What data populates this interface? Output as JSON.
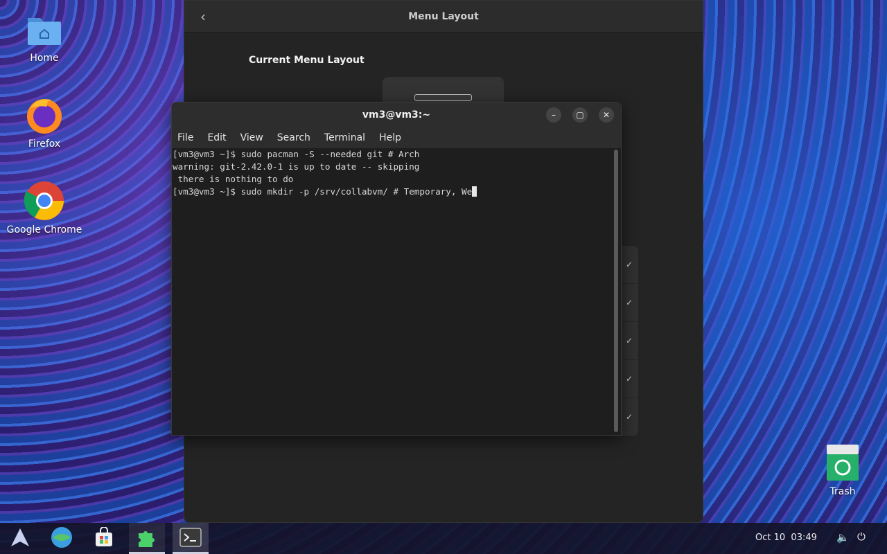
{
  "desktop": {
    "icons": [
      {
        "label": "Home"
      },
      {
        "label": "Firefox"
      },
      {
        "label": "Google Chrome"
      },
      {
        "label": "Trash"
      }
    ]
  },
  "settings": {
    "title": "Menu Layout",
    "heading": "Current Menu Layout"
  },
  "terminal": {
    "title": "vm3@vm3:~",
    "menu": [
      "File",
      "Edit",
      "View",
      "Search",
      "Terminal",
      "Help"
    ],
    "lines": [
      "[vm3@vm3 ~]$ sudo pacman -S --needed git # Arch",
      "warning: git-2.42.0-1 is up to date -- skipping",
      " there is nothing to do",
      "[vm3@vm3 ~]$ sudo mkdir -p /srv/collabvm/ # Temporary, We"
    ]
  },
  "taskbar": {
    "clock_date": "Oct 10",
    "clock_time": "03:49"
  }
}
